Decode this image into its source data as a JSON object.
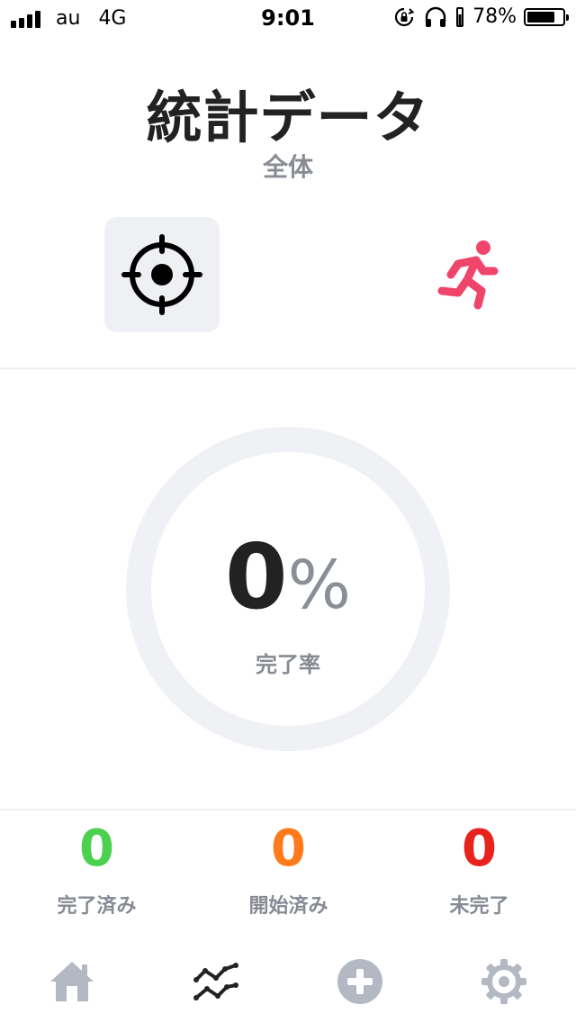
{
  "status_bar": {
    "carrier": "au",
    "network": "4G",
    "time": "9:01",
    "battery_text": "78%",
    "battery_level": 0.78
  },
  "header": {
    "title": "統計データ",
    "subtitle": "全体"
  },
  "modes": [
    {
      "icon": "target-icon",
      "selected": true
    },
    {
      "icon": "running-icon",
      "selected": false,
      "color": "#f0456a"
    }
  ],
  "progress": {
    "value": "0",
    "unit": "%",
    "label": "完了率",
    "fraction": 0
  },
  "stats": [
    {
      "value": "0",
      "label": "完了済み",
      "color": "#4cd050"
    },
    {
      "value": "0",
      "label": "開始済み",
      "color": "#ff7a1a"
    },
    {
      "value": "0",
      "label": "未完了",
      "color": "#e8231d"
    }
  ],
  "tabs": [
    {
      "icon": "home-icon",
      "active": false
    },
    {
      "icon": "stats-icon",
      "active": true
    },
    {
      "icon": "add-icon",
      "active": false
    },
    {
      "icon": "gear-icon",
      "active": false
    }
  ],
  "colors": {
    "inactive_tab": "#b3b8c2",
    "active_tab": "#222222",
    "ring_track": "#eff1f5"
  }
}
